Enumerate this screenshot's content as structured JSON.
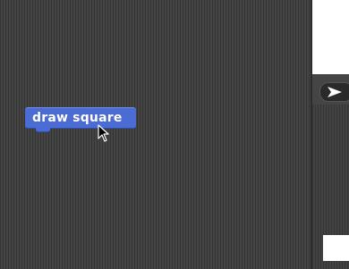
{
  "scripts": {
    "block_label": "draw square"
  },
  "icons": {
    "cursor": "pointer-cursor-icon",
    "run": "arrow-right-icon"
  },
  "colors": {
    "block": "#4a6cd4",
    "background": "#3c3c3c",
    "stage": "#ffffff"
  }
}
